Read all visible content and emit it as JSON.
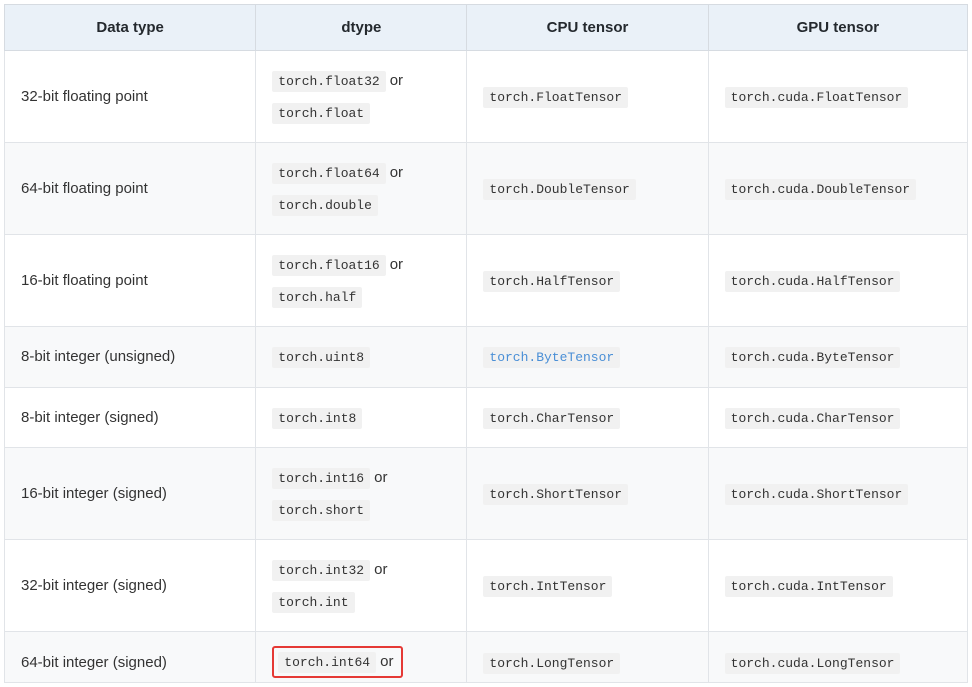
{
  "headers": {
    "datatype": "Data type",
    "dtype": "dtype",
    "cpu": "CPU tensor",
    "gpu": "GPU tensor"
  },
  "or": "or",
  "rows": [
    {
      "datatype": "32-bit floating point",
      "dtype_a": "torch.float32",
      "dtype_b": "torch.float",
      "cpu": "torch.FloatTensor",
      "gpu": "torch.cuda.FloatTensor",
      "cpu_link": false
    },
    {
      "datatype": "64-bit floating point",
      "dtype_a": "torch.float64",
      "dtype_b": "torch.double",
      "cpu": "torch.DoubleTensor",
      "gpu": "torch.cuda.DoubleTensor",
      "cpu_link": false
    },
    {
      "datatype": "16-bit floating point",
      "dtype_a": "torch.float16",
      "dtype_b": "torch.half",
      "cpu": "torch.HalfTensor",
      "gpu": "torch.cuda.HalfTensor",
      "cpu_link": false
    },
    {
      "datatype": "8-bit integer (unsigned)",
      "dtype_a": "torch.uint8",
      "dtype_b": null,
      "cpu": "torch.ByteTensor",
      "gpu": "torch.cuda.ByteTensor",
      "cpu_link": true
    },
    {
      "datatype": "8-bit integer (signed)",
      "dtype_a": "torch.int8",
      "dtype_b": null,
      "cpu": "torch.CharTensor",
      "gpu": "torch.cuda.CharTensor",
      "cpu_link": false
    },
    {
      "datatype": "16-bit integer (signed)",
      "dtype_a": "torch.int16",
      "dtype_b": "torch.short",
      "cpu": "torch.ShortTensor",
      "gpu": "torch.cuda.ShortTensor",
      "cpu_link": false
    },
    {
      "datatype": "32-bit integer (signed)",
      "dtype_a": "torch.int32",
      "dtype_b": "torch.int",
      "cpu": "torch.IntTensor",
      "gpu": "torch.cuda.IntTensor",
      "cpu_link": false
    },
    {
      "datatype": "64-bit integer (signed)",
      "dtype_a": "torch.int64",
      "dtype_b": null,
      "cpu": "torch.LongTensor",
      "gpu": "torch.cuda.LongTensor",
      "cpu_link": false,
      "highlight": true
    }
  ]
}
